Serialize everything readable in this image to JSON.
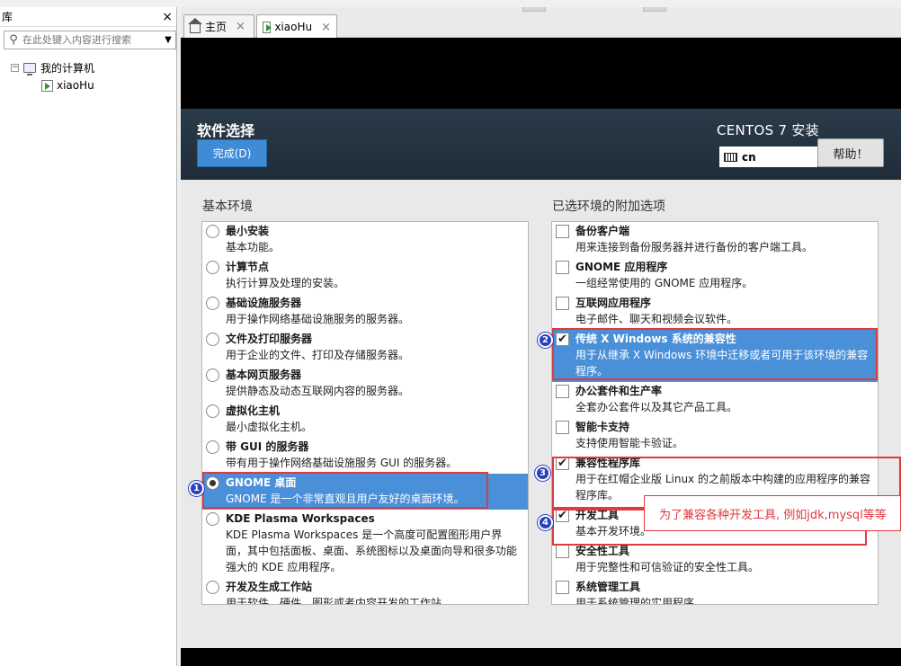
{
  "library": {
    "title": "库",
    "close_glyph": "×",
    "search_placeholder": "在此处键入内容进行搜索",
    "tree": {
      "root_expander": "⊟",
      "root_label": "我的计算机",
      "child_label": "xiaoHu"
    }
  },
  "tabs": [
    {
      "label": "主页",
      "close": "×"
    },
    {
      "label": "xiaoHu",
      "close": "×"
    }
  ],
  "installer": {
    "page_title": "软件选择",
    "done_button": "完成(D)",
    "install_title": "CENTOS 7 安装",
    "keyboard_layout": "cn",
    "help_button": "帮助！",
    "env_heading": "基本环境",
    "addon_heading": "已选环境的附加选项",
    "environments": [
      {
        "title": "最小安装",
        "desc": "基本功能。",
        "selected": false
      },
      {
        "title": "计算节点",
        "desc": "执行计算及处理的安装。",
        "selected": false
      },
      {
        "title": "基础设施服务器",
        "desc": "用于操作网络基础设施服务的服务器。",
        "selected": false
      },
      {
        "title": "文件及打印服务器",
        "desc": "用于企业的文件、打印及存储服务器。",
        "selected": false
      },
      {
        "title": "基本网页服务器",
        "desc": "提供静态及动态互联网内容的服务器。",
        "selected": false
      },
      {
        "title": "虚拟化主机",
        "desc": "最小虚拟化主机。",
        "selected": false
      },
      {
        "title": "带 GUI 的服务器",
        "desc": "带有用于操作网络基础设施服务 GUI 的服务器。",
        "selected": false
      },
      {
        "title": "GNOME 桌面",
        "desc": "GNOME 是一个非常直观且用户友好的桌面环境。",
        "selected": true
      },
      {
        "title": "KDE Plasma Workspaces",
        "desc": "KDE Plasma Workspaces 是一个高度可配置图形用户界面，其中包括面板、桌面、系统图标以及桌面向导和很多功能强大的 KDE 应用程序。",
        "selected": false
      },
      {
        "title": "开发及生成工作站",
        "desc": "用于软件、硬件、图形或者内容开发的工作站。",
        "selected": false
      }
    ],
    "addons": [
      {
        "title": "备份客户端",
        "desc": "用来连接到备份服务器并进行备份的客户端工具。",
        "checked": false,
        "selected": false
      },
      {
        "title": "GNOME 应用程序",
        "desc": "一组经常使用的 GNOME 应用程序。",
        "checked": false,
        "selected": false
      },
      {
        "title": "互联网应用程序",
        "desc": "电子邮件、聊天和视频会议软件。",
        "checked": false,
        "selected": false
      },
      {
        "title": "传统 X Windows 系统的兼容性",
        "desc": "用于从继承 X Windows 环境中迁移或者可用于该环境的兼容程序。",
        "checked": true,
        "selected": true
      },
      {
        "title": "办公套件和生产率",
        "desc": "全套办公套件以及其它产品工具。",
        "checked": false,
        "selected": false
      },
      {
        "title": "智能卡支持",
        "desc": "支持使用智能卡验证。",
        "checked": false,
        "selected": false
      },
      {
        "title": "兼容性程序库",
        "desc": "用于在红帽企业版 Linux 的之前版本中构建的应用程序的兼容程序库。",
        "checked": true,
        "selected": false
      },
      {
        "title": "开发工具",
        "desc": "基本开发环境。",
        "checked": true,
        "selected": false
      },
      {
        "title": "安全性工具",
        "desc": "用于完整性和可信验证的安全性工具。",
        "checked": false,
        "selected": false
      },
      {
        "title": "系统管理工具",
        "desc": "用于系统管理的实用程序。",
        "checked": false,
        "selected": false
      }
    ]
  },
  "annotations": {
    "badges": [
      "1",
      "2",
      "3",
      "4"
    ],
    "note": "为了兼容各种开发工具, 例如jdk,mysql等等"
  },
  "colors": {
    "selection": "#4a90d9",
    "done_button": "#3f8bd6",
    "banner": "#26333f",
    "annotation_red": "#e0393e",
    "badge_blue": "#2a3fb8"
  }
}
